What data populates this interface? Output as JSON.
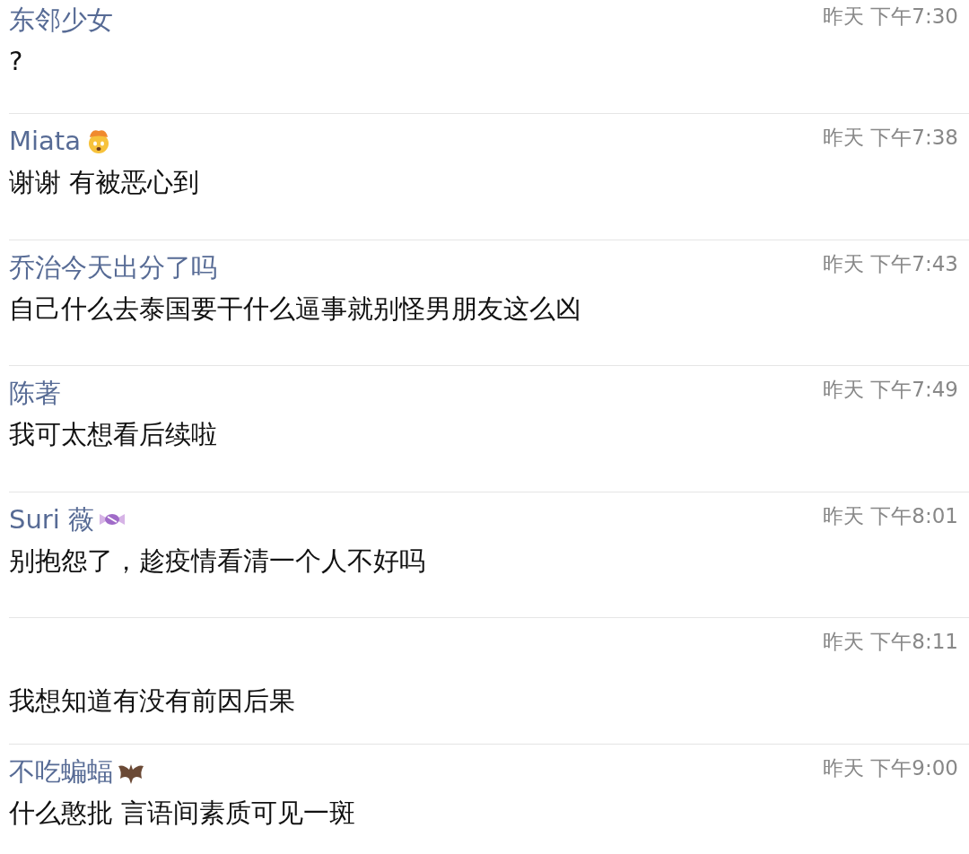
{
  "comments": [
    {
      "author": "东邻少女",
      "time": "昨天 下午7:30",
      "text": "?"
    },
    {
      "author": "Miata",
      "kind": "exploding-head",
      "time": "昨天 下午7:38",
      "text": "谢谢 有被恶心到"
    },
    {
      "author": "乔治今天出分了吗",
      "time": "昨天 下午7:43",
      "text": "自己什么去泰国要干什么逼事就别怪男朋友这么凶"
    },
    {
      "author": "陈著",
      "time": "昨天 下午7:49",
      "text": "我可太想看后续啦"
    },
    {
      "author": "Suri 薇",
      "kind": "candy",
      "time": "昨天 下午8:01",
      "text": "别抱怨了，趁疫情看清一个人不好吗"
    },
    {
      "time": "昨天 下午8:11",
      "text": "我想知道有没有前因后果"
    },
    {
      "author": "不吃蝙蝠",
      "kind": "bat",
      "time": "昨天 下午9:00",
      "text": "什么憨批 言语间素质可见一斑"
    }
  ]
}
